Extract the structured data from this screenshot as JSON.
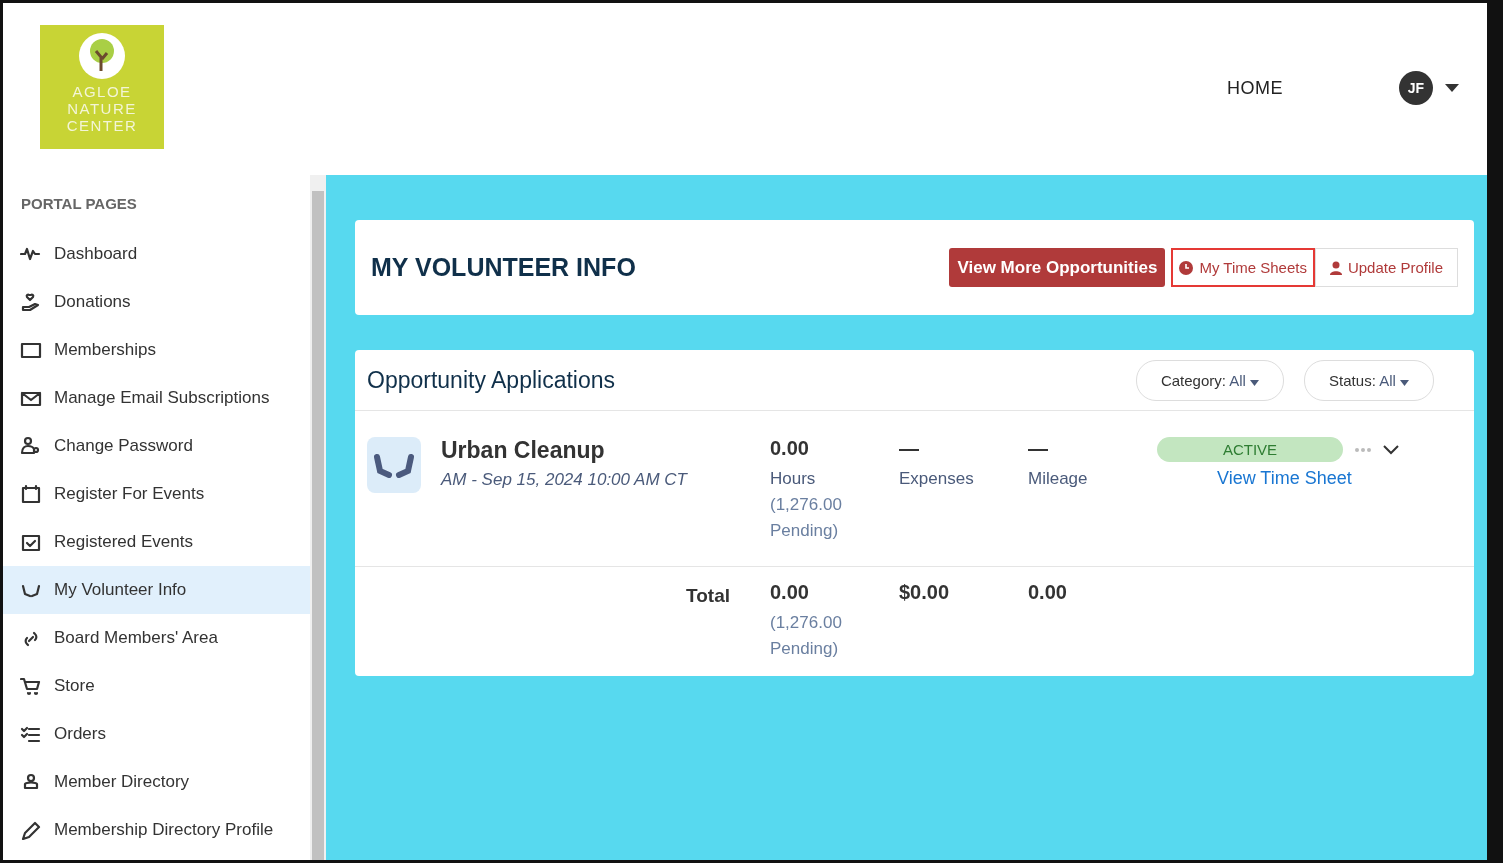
{
  "logo": {
    "lines": [
      "AGLOE",
      "NATURE",
      "CENTER"
    ]
  },
  "header": {
    "nav": "HOME",
    "avatar": "JF"
  },
  "sidebar": {
    "heading": "PORTAL PAGES",
    "items": [
      {
        "label": "Dashboard",
        "selected": false
      },
      {
        "label": "Donations",
        "selected": false
      },
      {
        "label": "Memberships",
        "selected": false
      },
      {
        "label": "Manage Email Subscriptions",
        "selected": false
      },
      {
        "label": "Change Password",
        "selected": false
      },
      {
        "label": "Register For Events",
        "selected": false
      },
      {
        "label": "Registered Events",
        "selected": false
      },
      {
        "label": "My Volunteer Info",
        "selected": true
      },
      {
        "label": "Board Members' Area",
        "selected": false
      },
      {
        "label": "Store",
        "selected": false
      },
      {
        "label": "Orders",
        "selected": false
      },
      {
        "label": "Member Directory",
        "selected": false
      },
      {
        "label": "Membership Directory Profile",
        "selected": false
      }
    ]
  },
  "volunteer": {
    "title": "MY VOLUNTEER INFO",
    "buttons": [
      {
        "label": "View More Opportunities",
        "kind": "primary",
        "highlighted": false
      },
      {
        "label": "My Time Sheets",
        "kind": "clock",
        "highlighted": true
      },
      {
        "label": "Update Profile",
        "kind": "person",
        "highlighted": false
      }
    ]
  },
  "applications": {
    "title": "Opportunity Applications",
    "filters": [
      {
        "label": "Category:",
        "value": "All"
      },
      {
        "label": "Status:",
        "value": "All"
      }
    ],
    "rows": [
      {
        "name": "Urban Cleanup",
        "date": "AM - Sep 15, 2024 10:00 AM CT",
        "hours": "0.00",
        "hours_label": "Hours",
        "pending": "(1,276.00 Pending)",
        "expenses": "—",
        "expenses_label": "Expenses",
        "mileage": "—",
        "mileage_label": "Mileage",
        "status": "ACTIVE",
        "link": "View Time Sheet"
      }
    ],
    "total": {
      "label": "Total",
      "hours": "0.00",
      "pending": "(1,276.00 Pending)",
      "expenses": "$0.00",
      "mileage": "0.00"
    }
  }
}
